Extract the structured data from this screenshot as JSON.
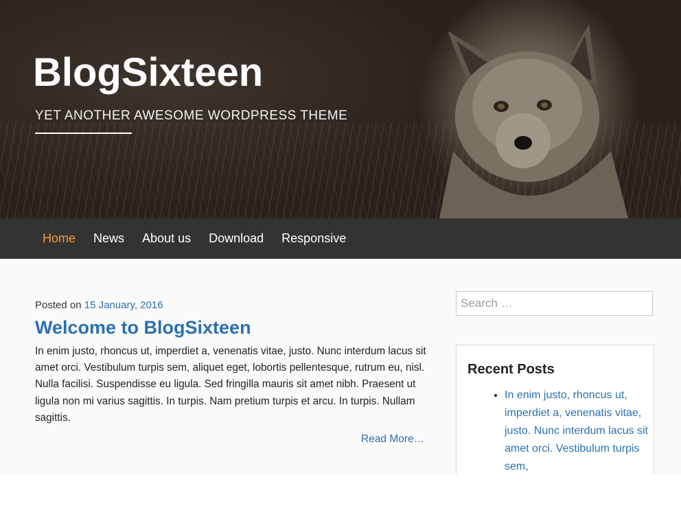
{
  "header": {
    "title": "BlogSixteen",
    "tagline": "YET ANOTHER AWESOME WORDPRESS THEME"
  },
  "nav": {
    "items": [
      {
        "label": "Home",
        "active": true
      },
      {
        "label": "News"
      },
      {
        "label": "About us"
      },
      {
        "label": "Download"
      },
      {
        "label": "Responsive"
      }
    ]
  },
  "post": {
    "posted_prefix": "Posted on",
    "date": "15 January, 2016",
    "title": "Welcome to BlogSixteen",
    "excerpt": "In enim justo, rhoncus ut, imperdiet a, venenatis vitae, justo. Nunc interdum lacus sit amet orci. Vestibulum turpis sem, aliquet eget, lobortis pellentesque, rutrum eu, nisl. Nulla facilisi. Suspendisse eu ligula. Sed fringilla mauris sit amet nibh. Praesent ut ligula non mi varius sagittis. In turpis. Nam pretium turpis et arcu. In turpis. Nullam sagittis.",
    "read_more": "Read More…"
  },
  "sidebar": {
    "search_placeholder": "Search …",
    "recent_posts_title": "Recent Posts",
    "recent_posts": [
      "In enim justo, rhoncus ut, imperdiet a, venenatis vitae, justo. Nunc interdum lacus sit amet orci. Vestibulum turpis sem,"
    ]
  },
  "colors": {
    "accent": "#f39c3c",
    "link": "#2b70b0",
    "nav_bg": "#333333"
  }
}
